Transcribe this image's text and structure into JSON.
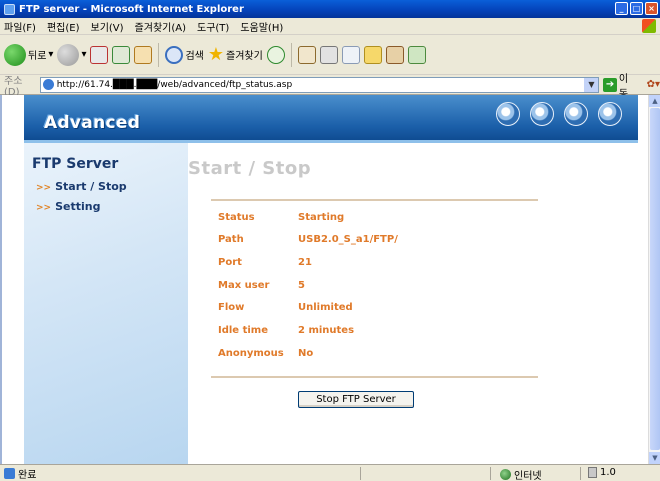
{
  "window": {
    "title": "FTP server - Microsoft Internet Explorer"
  },
  "menubar": {
    "items": [
      "파일(F)",
      "편집(E)",
      "보기(V)",
      "즐겨찾기(A)",
      "도구(T)",
      "도움말(H)"
    ]
  },
  "toolbar": {
    "back_label": "뒤로",
    "search_label": "검색",
    "favorites_label": "즐겨찾기"
  },
  "address": {
    "label": "주소(D)",
    "url": "http://61.74.███.███/web/advanced/ftp_status.asp",
    "go_label": "이동"
  },
  "page": {
    "banner_title": "Advanced",
    "sidebar": {
      "title": "FTP Server",
      "links": [
        {
          "label": "Start / Stop"
        },
        {
          "label": "Setting"
        }
      ]
    },
    "section_title": "Start / Stop",
    "info": [
      {
        "label": "Status",
        "value": "Starting"
      },
      {
        "label": "Path",
        "value": "USB2.0_S_a1/FTP/"
      },
      {
        "label": "Port",
        "value": "21"
      },
      {
        "label": "Max user",
        "value": "5"
      },
      {
        "label": "Flow",
        "value": "Unlimited"
      },
      {
        "label": "Idle time",
        "value": "2 minutes"
      },
      {
        "label": "Anonymous",
        "value": "No"
      }
    ],
    "stop_button": "Stop FTP Server"
  },
  "statusbar": {
    "status": "완료",
    "zone": "인터넷",
    "zoom": "1.0"
  },
  "colors": {
    "accent_orange": "#e07a2a",
    "banner_blue": "#1b5fa9",
    "sidebar_title": "#1a3a6e"
  }
}
